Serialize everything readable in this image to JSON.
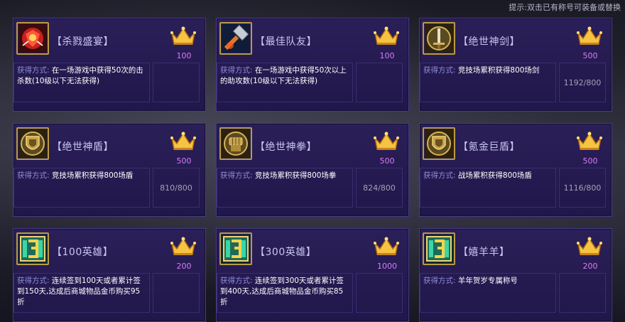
{
  "hint": "提示:双击已有称号可装备或替换",
  "desc_label": "获得方式:",
  "cards": [
    {
      "title": "【杀戮盛宴】",
      "points": "100",
      "desc": "在一场游戏中获得50次的击杀数(10级以下无法获得)",
      "progress": "",
      "icon": "red-dragon-icon"
    },
    {
      "title": "【最佳队友】",
      "points": "100",
      "desc": "在一场游戏中获得50次以上的助攻数(10级以下无法获得)",
      "progress": "",
      "icon": "hammer-icon"
    },
    {
      "title": "【绝世神剑】",
      "points": "500",
      "desc": "竞技场累积获得800场剑",
      "progress": "1192/800",
      "icon": "sword-shield-icon"
    },
    {
      "title": "【绝世神盾】",
      "points": "500",
      "desc": "竞技场累积获得800场盾",
      "progress": "810/800",
      "icon": "shield-icon"
    },
    {
      "title": "【绝世神拳】",
      "points": "500",
      "desc": "竞技场累积获得800场拳",
      "progress": "824/800",
      "icon": "fist-icon"
    },
    {
      "title": "【氪金巨盾】",
      "points": "500",
      "desc": "战场累积获得800场盾",
      "progress": "1116/800",
      "icon": "shield-icon"
    },
    {
      "title": "【100英雄】",
      "points": "200",
      "desc": "连续签到100天或者累计签到150天,达成后商城物品金币购买95折",
      "progress": "",
      "icon": "number-3-icon"
    },
    {
      "title": "【300英雄】",
      "points": "1000",
      "desc": "连续签到300天或者累计签到400天,达成后商城物品金币购买85折",
      "progress": "",
      "icon": "number-3-icon"
    },
    {
      "title": "【嬉羊羊】",
      "points": "200",
      "desc": "羊年贺岁专属称号",
      "progress": "",
      "icon": "number-3-icon"
    }
  ]
}
